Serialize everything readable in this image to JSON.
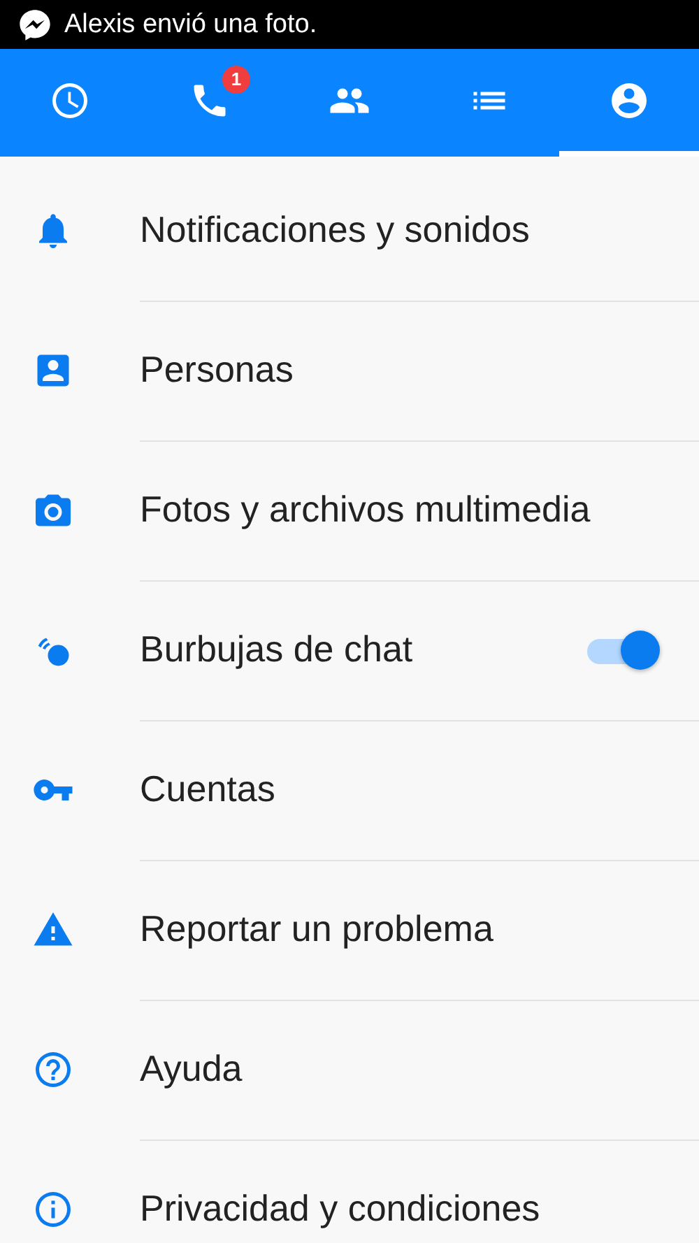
{
  "status_bar": {
    "notification": "Alexis envió una foto."
  },
  "tabs": [
    {
      "selected": false
    },
    {
      "selected": false,
      "badge": "1"
    },
    {
      "selected": false
    },
    {
      "selected": false
    },
    {
      "selected": true
    }
  ],
  "settings": [
    {
      "label": "Notificaciones y sonidos",
      "kind": "link"
    },
    {
      "label": "Personas",
      "kind": "link"
    },
    {
      "label": "Fotos y archivos multimedia",
      "kind": "link"
    },
    {
      "label": "Burbujas de chat",
      "kind": "toggle",
      "on": true
    },
    {
      "label": "Cuentas",
      "kind": "link"
    },
    {
      "label": "Reportar un problema",
      "kind": "link"
    },
    {
      "label": "Ayuda",
      "kind": "link"
    },
    {
      "label": "Privacidad y condiciones",
      "kind": "link"
    }
  ]
}
